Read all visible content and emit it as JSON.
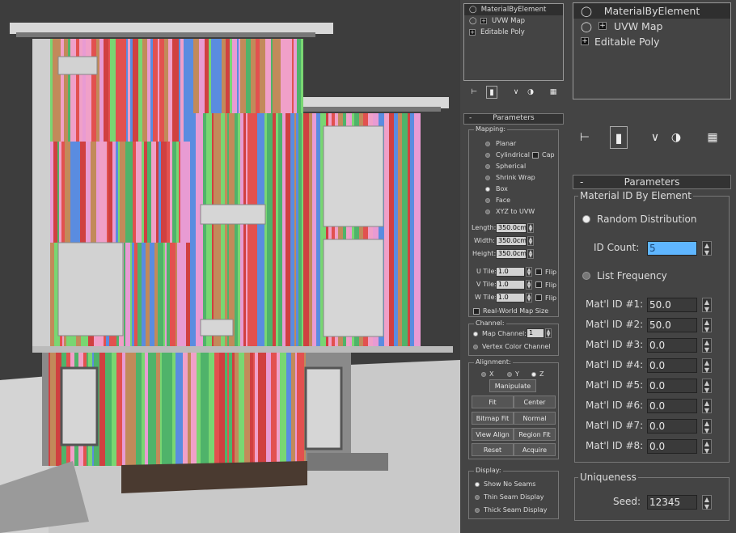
{
  "stack_small": {
    "items": [
      {
        "label": "MaterialByElement",
        "icon": "bulb"
      },
      {
        "label": "UVW Map",
        "icon": "bulb-plus"
      },
      {
        "label": "Editable Poly",
        "icon": "plus"
      }
    ]
  },
  "stack_large": {
    "items": [
      {
        "label": "MaterialByElement",
        "icon": "bulb"
      },
      {
        "label": "UVW Map",
        "icon": "bulb-plus"
      },
      {
        "label": "Editable Poly",
        "icon": "plus"
      }
    ]
  },
  "uvw": {
    "rollout_minus": "-",
    "rollout_title": "Parameters",
    "mapping_title": "Mapping:",
    "mapping_options": [
      "Planar",
      "Cylindrical",
      "Spherical",
      "Shrink Wrap",
      "Box",
      "Face",
      "XYZ to UVW"
    ],
    "mapping_selected": "Box",
    "cap_label": "Cap",
    "length_label": "Length:",
    "length_value": "350.0cm",
    "width_label": "Width:",
    "width_value": "350.0cm",
    "height_label": "Height:",
    "height_value": "350.0cm",
    "utile_label": "U Tile:",
    "utile_value": "1.0",
    "vtile_label": "V Tile:",
    "vtile_value": "1.0",
    "wtile_label": "W Tile:",
    "wtile_value": "1.0",
    "flip_label": "Flip",
    "realworld_label": "Real-World Map Size",
    "channel_title": "Channel:",
    "map_channel_label": "Map Channel:",
    "map_channel_value": "1",
    "vertex_color_label": "Vertex Color Channel",
    "alignment_title": "Alignment:",
    "axis_x": "X",
    "axis_y": "Y",
    "axis_z": "Z",
    "axis_selected": "Z",
    "buttons": {
      "manipulate": "Manipulate",
      "fit": "Fit",
      "center": "Center",
      "bitmap_fit": "Bitmap Fit",
      "normal_align": "Normal Align",
      "view_align": "View Align",
      "region_fit": "Region Fit",
      "reset": "Reset",
      "acquire": "Acquire"
    },
    "display_title": "Display:",
    "display_options": [
      "Show No Seams",
      "Thin Seam Display",
      "Thick Seam Display"
    ],
    "display_selected": "Show No Seams"
  },
  "mbe": {
    "rollout_minus": "-",
    "rollout_title": "Parameters",
    "group_title": "Material ID By Element",
    "random_label": "Random Distribution",
    "id_count_label": "ID Count:",
    "id_count_value": "5",
    "list_freq_label": "List Frequency",
    "mat_ids": [
      {
        "label": "Mat'l ID #1:",
        "value": "50.0"
      },
      {
        "label": "Mat'l ID #2:",
        "value": "50.0"
      },
      {
        "label": "Mat'l ID #3:",
        "value": "0.0"
      },
      {
        "label": "Mat'l ID #4:",
        "value": "0.0"
      },
      {
        "label": "Mat'l ID #5:",
        "value": "0.0"
      },
      {
        "label": "Mat'l ID #6:",
        "value": "0.0"
      },
      {
        "label": "Mat'l ID #7:",
        "value": "0.0"
      },
      {
        "label": "Mat'l ID #8:",
        "value": "0.0"
      }
    ],
    "uniqueness_title": "Uniqueness",
    "seed_label": "Seed:",
    "seed_value": "12345"
  },
  "colors": {
    "stripe_palette": [
      "#e2514f",
      "#5a8ce0",
      "#79d672",
      "#e89bd3",
      "#c28a5a",
      "#f0a0c8",
      "#4fb36a",
      "#d04040"
    ],
    "highlight": "#5fb6ff"
  }
}
